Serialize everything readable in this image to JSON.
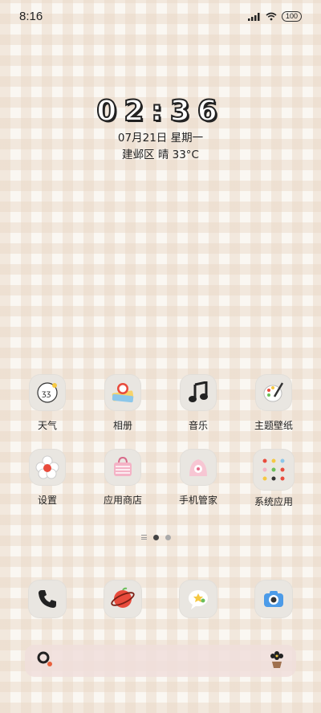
{
  "status_bar": {
    "time": "8:16",
    "battery": "100"
  },
  "clock": {
    "time": "02:36",
    "date": "07月21日 星期一",
    "weather": "建邺区 晴 33°C"
  },
  "apps_row1": [
    {
      "label": "天气",
      "icon": "weather-icon"
    },
    {
      "label": "相册",
      "icon": "gallery-icon"
    },
    {
      "label": "音乐",
      "icon": "music-icon"
    },
    {
      "label": "主题壁纸",
      "icon": "theme-icon"
    }
  ],
  "apps_row2": [
    {
      "label": "设置",
      "icon": "settings-icon"
    },
    {
      "label": "应用商店",
      "icon": "app-store-icon"
    },
    {
      "label": "手机管家",
      "icon": "phone-manager-icon"
    },
    {
      "label": "系统应用",
      "icon": "system-apps-icon"
    }
  ],
  "page_indicator": {
    "pages": 2,
    "current": 1
  },
  "dock": [
    {
      "icon": "phone-icon"
    },
    {
      "icon": "browser-icon"
    },
    {
      "icon": "messages-icon"
    },
    {
      "icon": "camera-icon"
    }
  ],
  "search": {
    "icon": "search-icon",
    "right_icon": "flower-pot-icon"
  },
  "colors": {
    "background": "#faf7f2",
    "check": "#e8d6c4",
    "icon_bg": "#e9e6e1",
    "search_bg": "#f0dedc"
  }
}
